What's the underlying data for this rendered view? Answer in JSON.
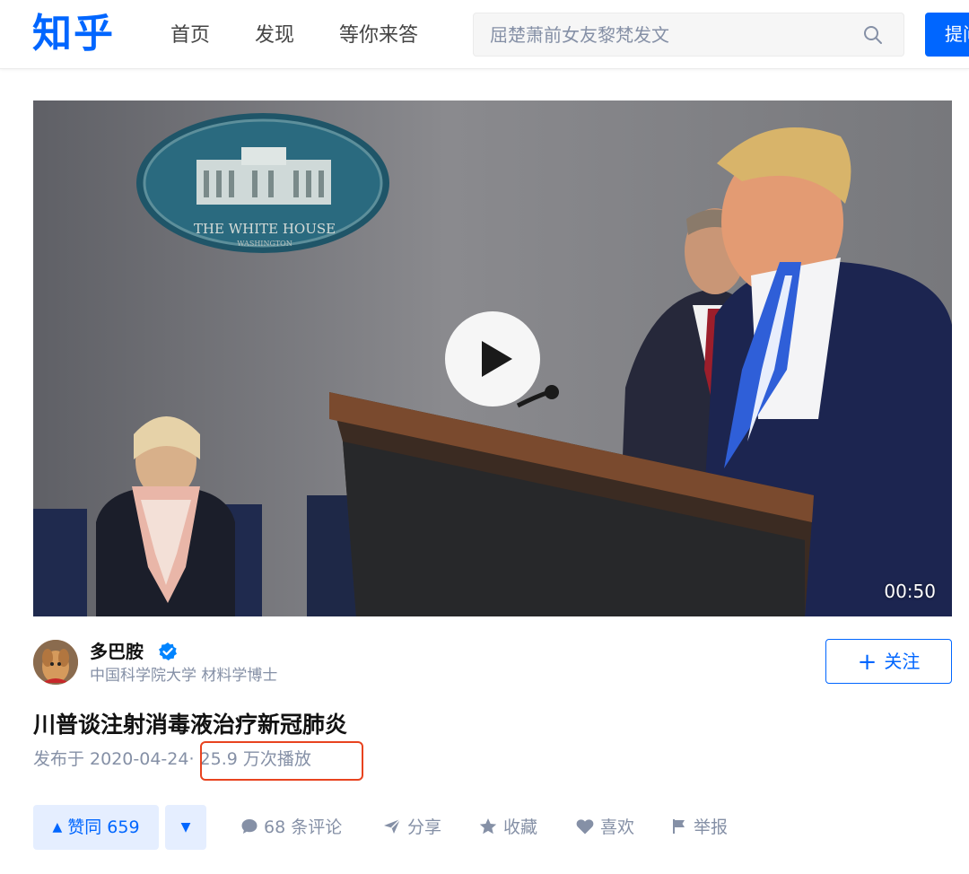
{
  "header": {
    "logo": "知乎",
    "nav": [
      "首页",
      "发现",
      "等你来答"
    ],
    "search_placeholder": "屈楚萧前女友黎梵发文",
    "ask_label": "提问"
  },
  "video": {
    "duration": "00:50",
    "scene_text_1": "THE WHITE HOUSE",
    "scene_text_2": "WASHINGTON"
  },
  "author": {
    "name": "多巴胺",
    "bio": "中国科学院大学 材料学博士",
    "follow_label": "关注"
  },
  "post": {
    "title": "川普谈注射消毒液治疗新冠肺炎",
    "published": "发布于 2020-04-24",
    "views": "· 25.9 万次播放"
  },
  "actions": {
    "vote_up": "赞同 659",
    "comments": "68 条评论",
    "share": "分享",
    "collect": "收藏",
    "like": "喜欢",
    "report": "举报"
  },
  "colors": {
    "brand": "#0066ff",
    "highlight": "#e8431f"
  }
}
